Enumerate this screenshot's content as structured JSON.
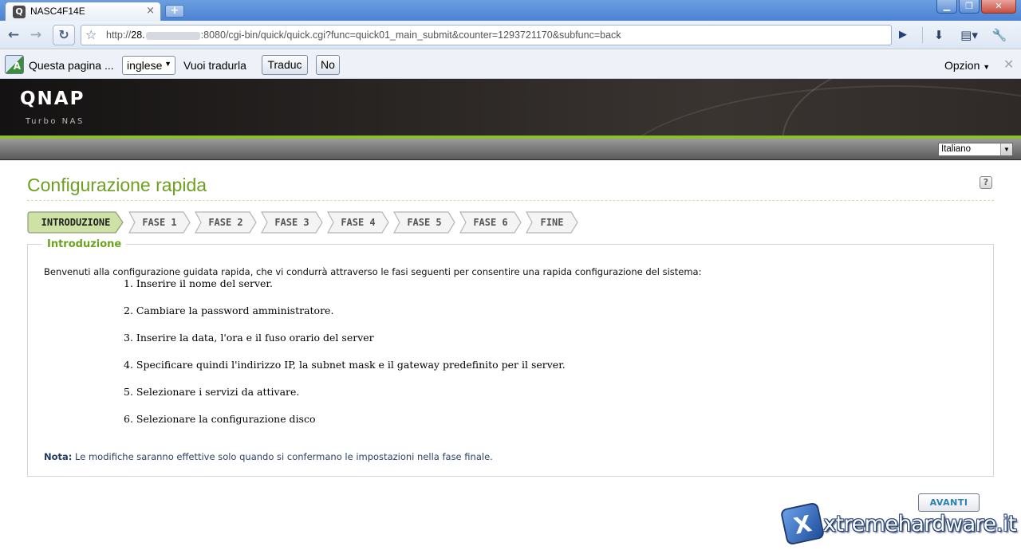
{
  "browser": {
    "tab_title": "NASC4F14E",
    "tab_favicon": "qnap-icon",
    "url_prefix": "http://",
    "url_host": "28.",
    "url_rest": ":8080/cgi-bin/quick/quick.cgi?func=quick01_main_submit&counter=1293721170&subfunc=back",
    "window_buttons": [
      "minimize",
      "restore",
      "close"
    ]
  },
  "translate_bar": {
    "message": "Questa pagina ...",
    "language": "inglese",
    "question": "Vuoi tradurla",
    "translate_label": "Traduc",
    "no_label": "No",
    "options_label": "Opzion"
  },
  "header": {
    "logo": "QNAP",
    "subtitle": "Turbo NAS",
    "language_select": "Italiano"
  },
  "page": {
    "title": "Configurazione rapida",
    "help_label": "?"
  },
  "wizard": {
    "steps": [
      "INTRODUZIONE",
      "FASE 1",
      "FASE 2",
      "FASE 3",
      "FASE 4",
      "FASE 5",
      "FASE 6",
      "FINE"
    ],
    "active_step": "INTRODUZIONE",
    "active_color": "#cfe2a6",
    "inactive_color": "#f4f4f4"
  },
  "intro": {
    "legend": "Introduzione",
    "text": "Benvenuti alla configurazione guidata rapida, che vi condurrà attraverso le fasi seguenti per consentire una rapida configurazione del sistema:",
    "items": [
      "1. Inserire il nome del server.",
      "2. Cambiare la password amministratore.",
      "3. Inserire la data, l'ora e il fuso orario del server",
      "4. Specificare quindi l'indirizzo IP, la subnet mask e il gateway predefinito per il server.",
      "5. Selezionare i servizi da attivare.",
      "6. Selezionare la configurazione disco"
    ],
    "note_label": "Nota:",
    "note_text": " Le modifiche saranno effettive solo quando si confermano le impostazioni nella fase finale."
  },
  "actions": {
    "next_label": "AVANTI"
  },
  "watermark": {
    "text": "xtremehardware.it",
    "badge": "X"
  },
  "colors": {
    "accent_green": "#6ea020",
    "stripe_green": "#8bbf2b"
  }
}
